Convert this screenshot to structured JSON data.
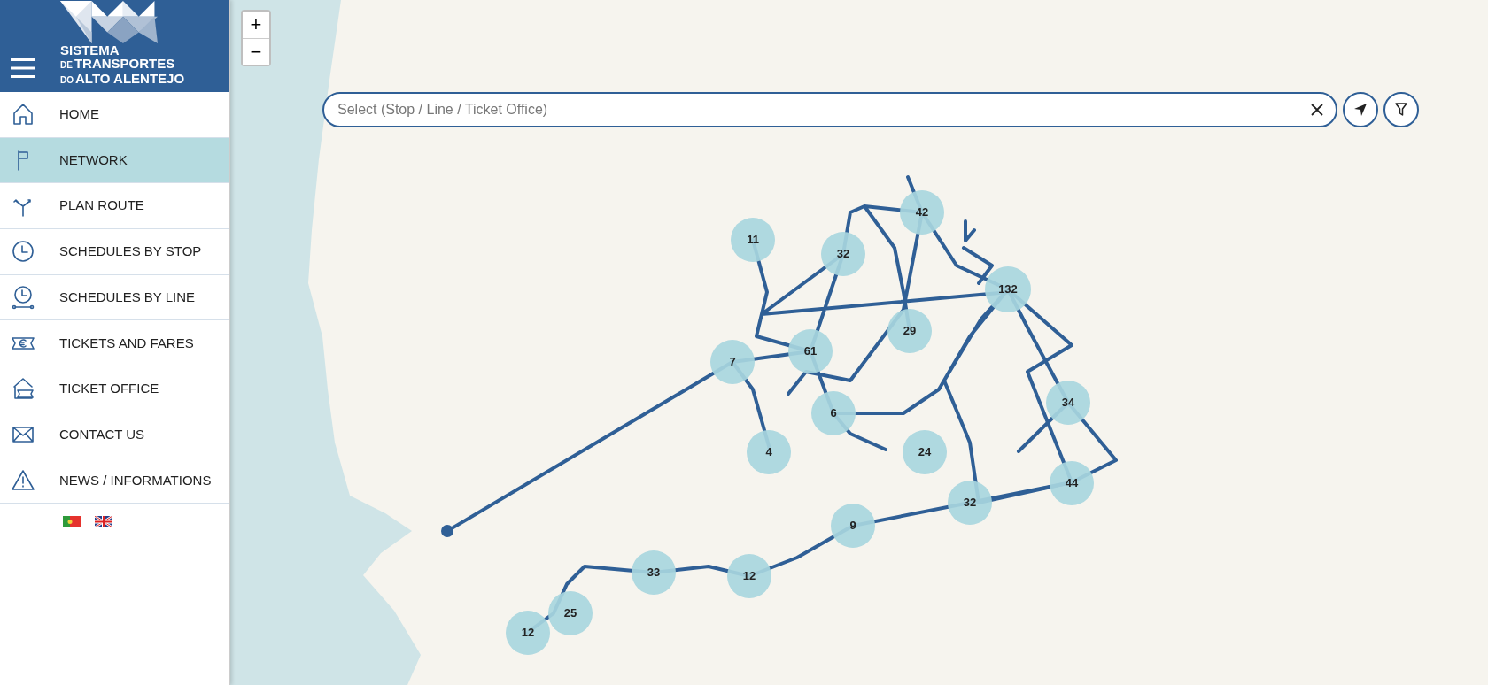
{
  "logo": {
    "line_1": "SISTEMA",
    "line_2_small": "DE",
    "line_2": "TRANSPORTES",
    "line_3_small": "DO",
    "line_3": "ALTO ALENTEJO"
  },
  "menu": [
    {
      "label": "HOME",
      "selected": false
    },
    {
      "label": "NETWORK",
      "selected": true
    },
    {
      "label": "PLAN ROUTE",
      "selected": false
    },
    {
      "label": "SCHEDULES BY STOP",
      "selected": false
    },
    {
      "label": "SCHEDULES BY LINE",
      "selected": false
    },
    {
      "label": "TICKETS AND FARES",
      "selected": false
    },
    {
      "label": "TICKET OFFICE",
      "selected": false
    },
    {
      "label": "CONTACT US",
      "selected": false
    },
    {
      "label": "NEWS / INFORMATIONS",
      "selected": false
    }
  ],
  "zoom": {
    "in": "+",
    "out": "−"
  },
  "search": {
    "placeholder": "Select (Stop / Line / Ticket Office)"
  },
  "clusters": [
    {
      "count": "11"
    },
    {
      "count": "32"
    },
    {
      "count": "42"
    },
    {
      "count": "132"
    },
    {
      "count": "29"
    },
    {
      "count": "61"
    },
    {
      "count": "7"
    },
    {
      "count": "6"
    },
    {
      "count": "34"
    },
    {
      "count": "4"
    },
    {
      "count": "24"
    },
    {
      "count": "44"
    },
    {
      "count": "32"
    },
    {
      "count": "9"
    },
    {
      "count": "33"
    },
    {
      "count": "12"
    },
    {
      "count": "25"
    },
    {
      "count": "12"
    }
  ]
}
